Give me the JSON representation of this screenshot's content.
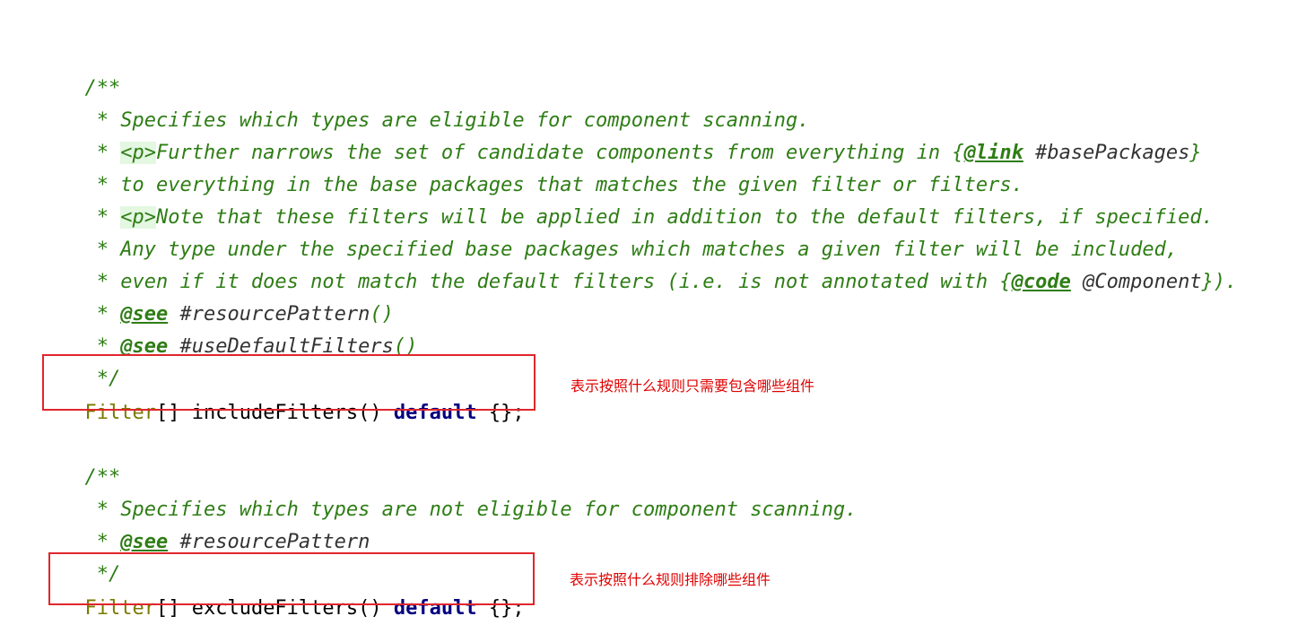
{
  "block1": {
    "open": "/**",
    "l1_prefix": " * ",
    "l1_text": "Specifies which types are eligible for component scanning.",
    "l2_prefix": " * ",
    "l2_tag": "<p>",
    "l2_text": "Further narrows the set of candidate components from everything in {",
    "l2_link_tag": "@link",
    "l2_link_ref": " #basePackages",
    "l2_close": "}",
    "l3_text": " * to everything in the base packages that matches the given filter or filters.",
    "l4_prefix": " * ",
    "l4_tag": "<p>",
    "l4_text": "Note that these filters will be applied in addition to the default filters, if specified.",
    "l5_text": " * Any type under the specified base packages which matches a given filter will be included,",
    "l6_text": " * even if it does not match the default filters (i.e. is not annotated with {",
    "l6_code_tag": "@code",
    "l6_code_ref": " @Component",
    "l6_close": "}).",
    "see1_prefix": " * ",
    "see1_tag": "@see",
    "see1_ref": " #resourcePattern",
    "see1_paren": "()",
    "see2_prefix": " * ",
    "see2_tag": "@see",
    "see2_ref": " #useDefaultFilters",
    "see2_paren": "()",
    "close": " */",
    "code_type": "Filter",
    "code_rest": "[] includeFilters() ",
    "code_kw": "default",
    "code_end": " {};",
    "note": "表示按照什么规则只需要包含哪些组件"
  },
  "block2": {
    "open": "/**",
    "l1_prefix": " * ",
    "l1_text": "Specifies which types are not eligible for component scanning.",
    "see_prefix": " * ",
    "see_tag": "@see",
    "see_ref": " #resourcePattern",
    "close": " */",
    "code_type": "Filter",
    "code_rest": "[] excludeFilters() ",
    "code_kw": "default",
    "code_end": " {};",
    "note": "表示按照什么规则排除哪些组件"
  },
  "colors": {
    "comment": "#2e7d15",
    "keyword": "#000080",
    "type": "#7a7a00",
    "highlight_box": "#e0262b",
    "note_text": "#e00000"
  }
}
